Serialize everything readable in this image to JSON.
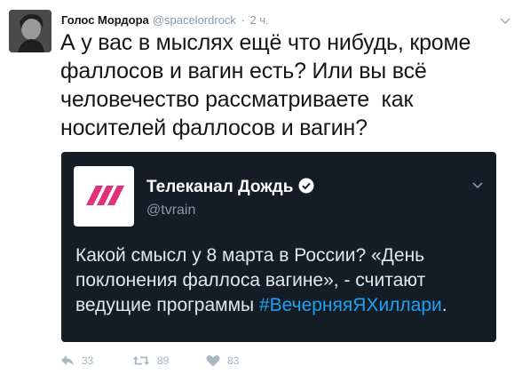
{
  "tweet": {
    "author_name": "Голос Мордора",
    "author_handle": "@spacelordrock",
    "separator": "·",
    "time": "2 ч.",
    "text": "А у вас в мыслях ещё что нибудь, кроме фаллосов и вагин есть? Или вы всё человечество рассматриваете  как носителей фаллосов и вагин?"
  },
  "quoted_tweet": {
    "author_name": "Телеканал Дождь",
    "author_handle": "@tvrain",
    "verified": true,
    "text_before": "Какой смысл у 8 марта в России? «День поклонения фаллоса вагине», - считают ведущие программы ",
    "hashtag": "#ВечерняяЯХиллари",
    "text_after": ".",
    "logo_color": "#e2307a"
  },
  "actions": {
    "reply_count": "33",
    "retweet_count": "89",
    "like_count": "83"
  },
  "colors": {
    "card_bg": "#141d26",
    "link": "#1da1f2",
    "muted": "#8899a6",
    "action_gray": "#aab8c2"
  },
  "icons": [
    "avatar",
    "chevron-down-icon",
    "verified-badge-icon",
    "tvrain-logo",
    "reply-icon",
    "retweet-icon",
    "heart-icon"
  ]
}
